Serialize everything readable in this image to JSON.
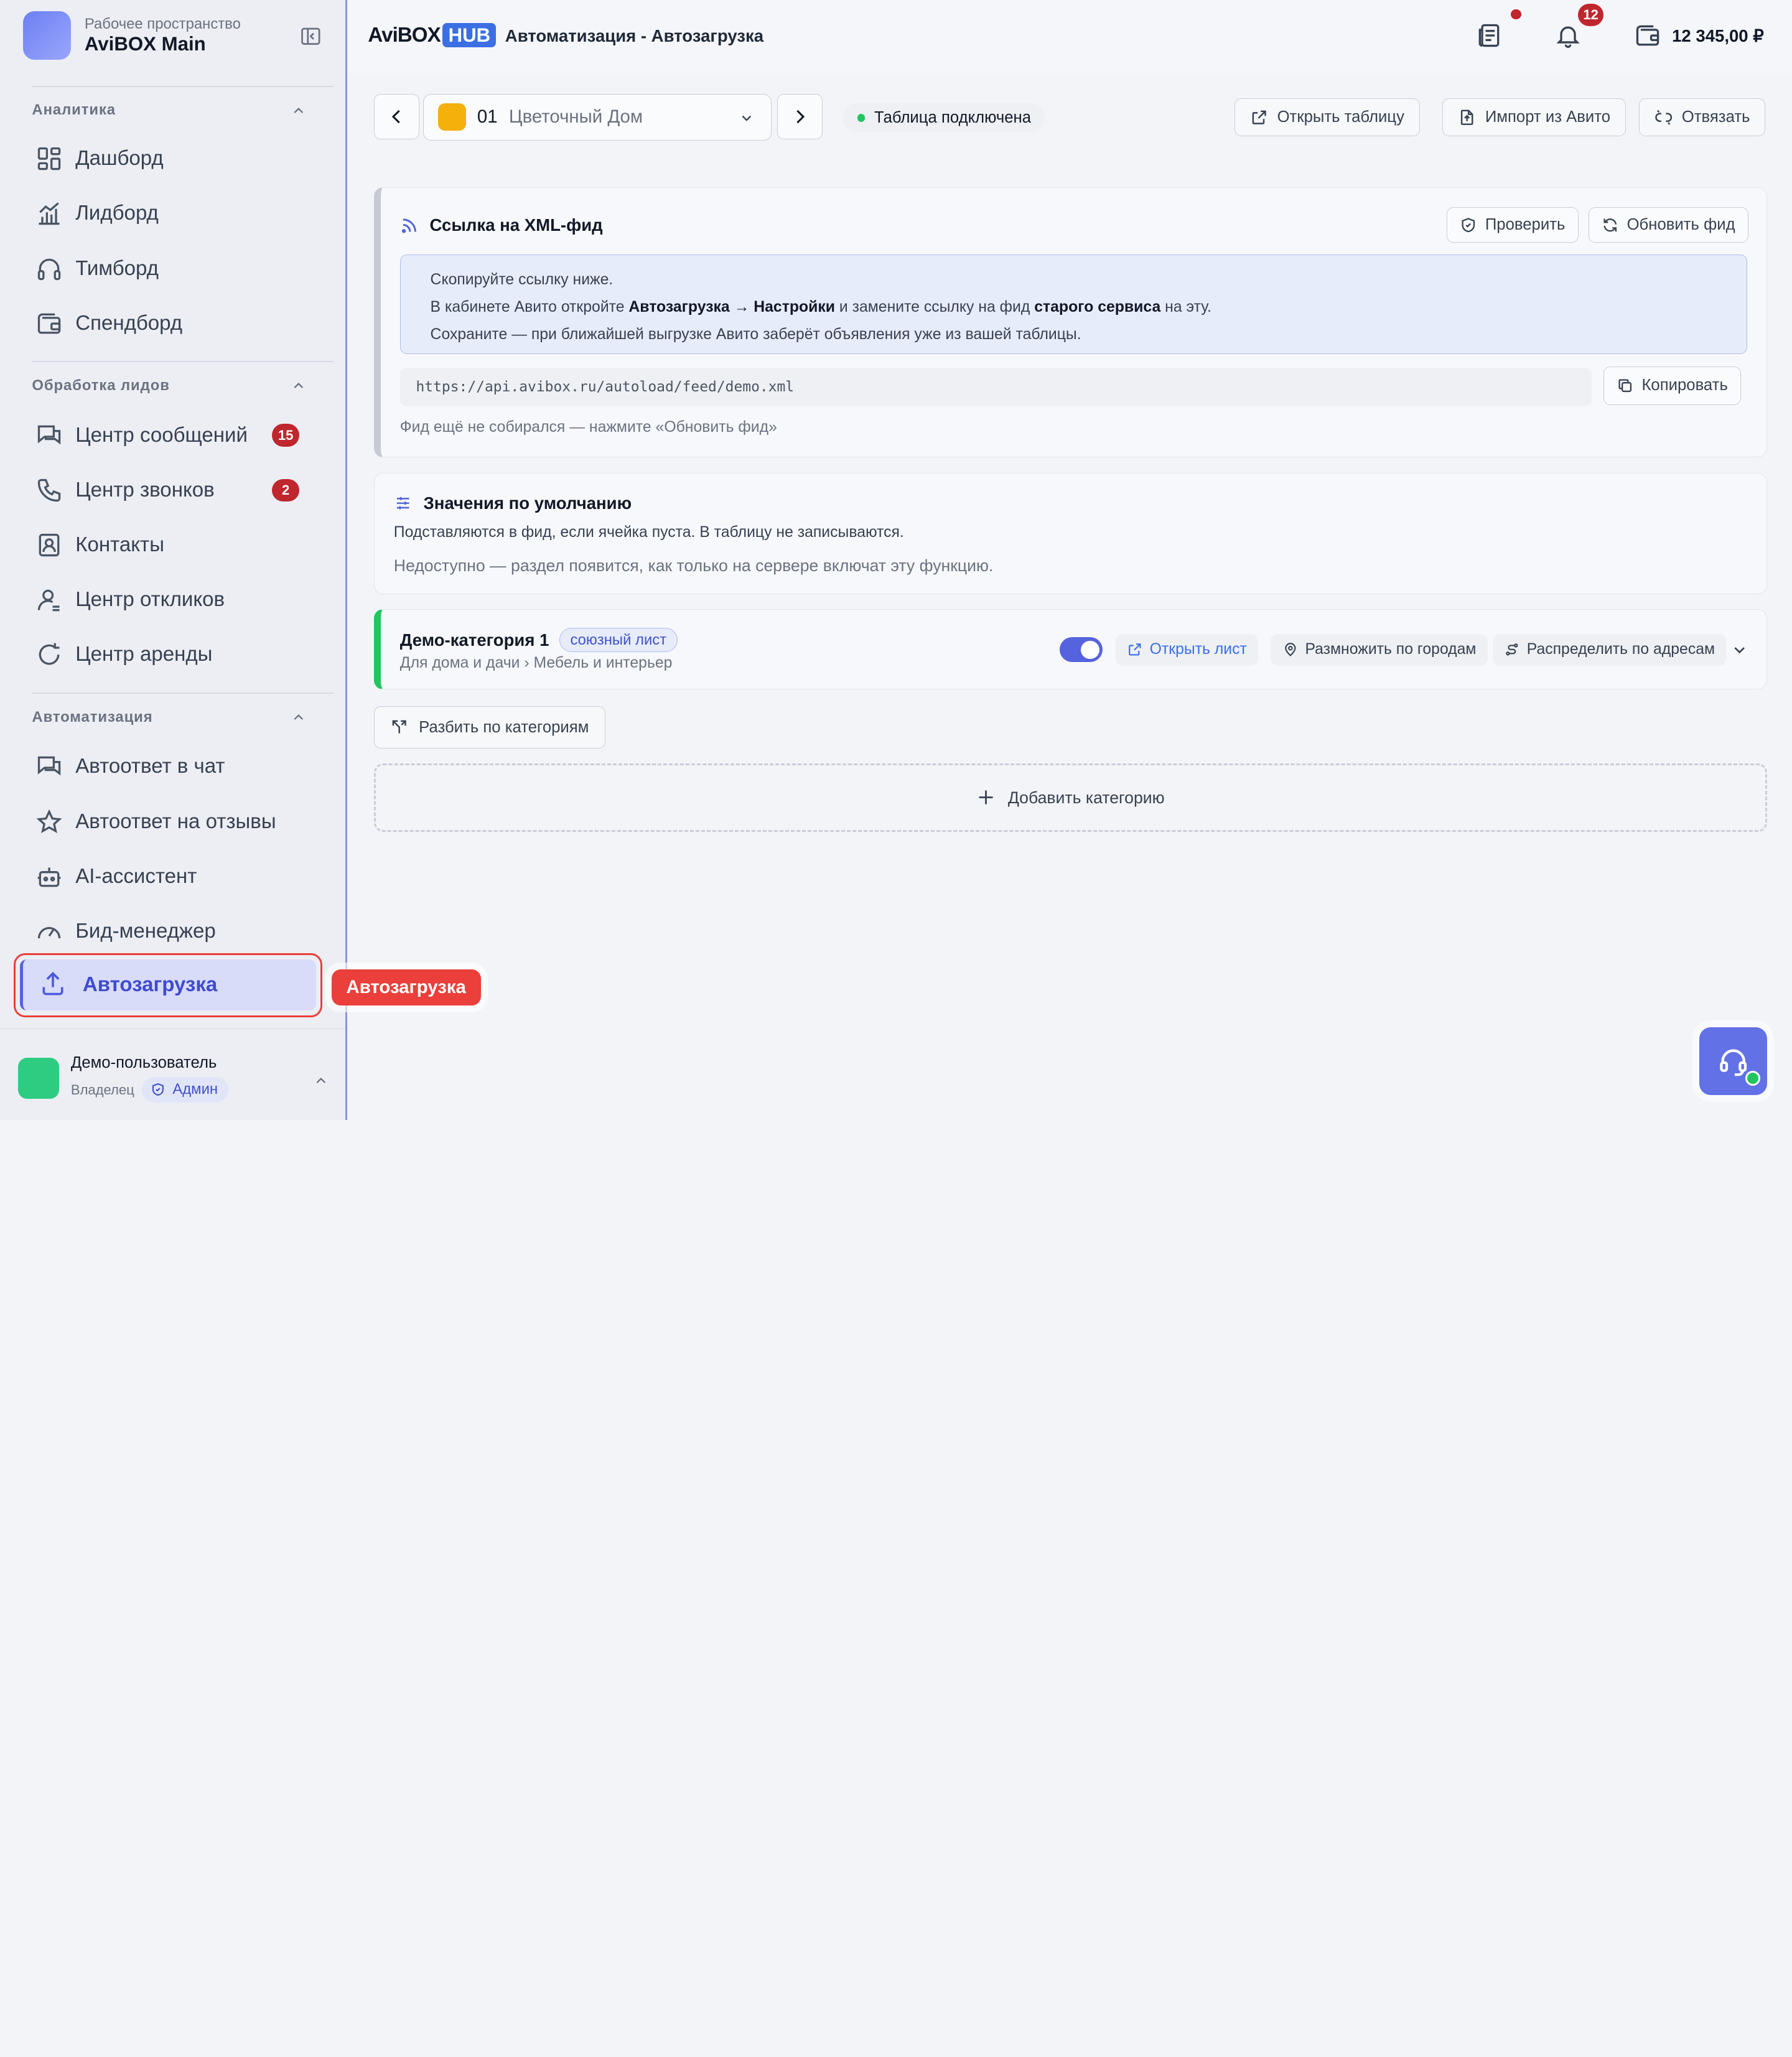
{
  "workspace": {
    "label": "Рабочее пространство",
    "name": "AviBOX Main"
  },
  "sidebar": {
    "sections": [
      {
        "title": "Аналитика",
        "items": [
          {
            "label": "Дашборд",
            "icon": "dashboard-icon"
          },
          {
            "label": "Лидборд",
            "icon": "chart-icon"
          },
          {
            "label": "Тимборд",
            "icon": "headphones-icon"
          },
          {
            "label": "Спендборд",
            "icon": "wallet-icon"
          }
        ]
      },
      {
        "title": "Обработка лидов",
        "items": [
          {
            "label": "Центр сообщений",
            "icon": "messages-icon",
            "badge": "15"
          },
          {
            "label": "Центр звонков",
            "icon": "phone-icon",
            "badge": "2"
          },
          {
            "label": "Контакты",
            "icon": "contacts-icon"
          },
          {
            "label": "Центр откликов",
            "icon": "user-icon"
          },
          {
            "label": "Центр аренды",
            "icon": "refresh-icon"
          }
        ]
      },
      {
        "title": "Автоматизация",
        "items": [
          {
            "label": "Автоответ в чат",
            "icon": "chat-icon"
          },
          {
            "label": "Автоответ на отзывы",
            "icon": "star-icon"
          },
          {
            "label": "AI-ассистент",
            "icon": "robot-icon"
          },
          {
            "label": "Бид-менеджер",
            "icon": "gauge-icon"
          },
          {
            "label": "Автозагрузка",
            "icon": "upload-icon",
            "active": true
          }
        ]
      }
    ],
    "tooltip": "Автозагрузка"
  },
  "user": {
    "name": "Демо-пользователь",
    "role": "Владелец",
    "badge": "Админ"
  },
  "header": {
    "brand_main": "AviBOX",
    "brand_hub": "HUB",
    "title": "Автоматизация - Автозагрузка",
    "notifications_count": "12",
    "balance": "12 345,00 ₽"
  },
  "toolbar": {
    "selector_number": "01",
    "selector_name": "Цветочный Дом",
    "status": "Таблица подключена",
    "open_table": "Открыть таблицу",
    "import": "Импорт из Авито",
    "unlink": "Отвязать"
  },
  "xml": {
    "title": "Ссылка на XML-фид",
    "check": "Проверить",
    "refresh": "Обновить фид",
    "line1": "Скопируйте ссылку ниже.",
    "line2_a": "В кабинете Авито откройте ",
    "line2_b": "Автозагрузка → Настройки",
    "line2_c": " и замените ссылку на фид ",
    "line2_d": "старого сервиса",
    "line2_e": " на эту.",
    "line3": "Сохраните — при ближайшей выгрузке Авито заберёт объявления уже из вашей таблицы.",
    "url": "https://api.avibox.ru/autoload/feed/demo.xml",
    "copy": "Копировать",
    "note": "Фид ещё не собирался — нажмите «Обновить фид»"
  },
  "defaults": {
    "title": "Значения по умолчанию",
    "subtitle": "Подставляются в фид, если ячейка пуста. В таблицу не записываются.",
    "unavailable": "Недоступно — раздел появится, как только на сервере включат эту функцию."
  },
  "category": {
    "name": "Демо-категория 1",
    "tag": "союзный лист",
    "path": "Для дома и дачи › Мебель и интерьер",
    "enabled": true,
    "open_sheet": "Открыть лист",
    "multiply": "Размножить по городам",
    "distribute": "Распределить по адресам"
  },
  "split_label": "Разбить по категориям",
  "add_label": "Добавить категорию",
  "colors": {
    "accent": "#5563de",
    "danger": "#ea3f3a",
    "success": "#22c55e"
  }
}
